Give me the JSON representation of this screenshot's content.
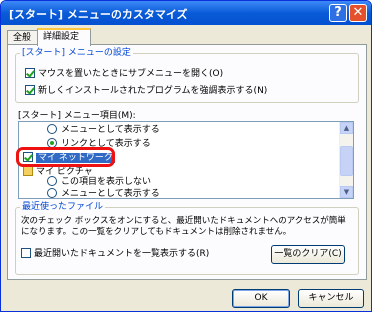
{
  "window": {
    "title": "[スタート] メニューのカスタマイズ",
    "help_label": "?",
    "close_label": "✕"
  },
  "tabs": [
    "全般",
    "詳細設定"
  ],
  "start_settings": {
    "legend": "[スタート] メニューの設定",
    "options": [
      "マウスを置いたときにサブメニューを開く(O)",
      "新しくインストールされたプログラムを強調表示する(N)"
    ]
  },
  "items": {
    "label": "[スタート] メニュー項目(M):",
    "rows": [
      "メニューとして表示する",
      "リンクとして表示する",
      "マイ ネットワーク",
      "マイ ピクチャ",
      "この項目を表示しない",
      "メニューとして表示する"
    ]
  },
  "recent": {
    "legend": "最近使ったファイル",
    "description": "次のチェック ボックスをオンにすると、最近開いたドキュメントへのアクセスが簡単になります。この一覧をクリアしてもドキュメントは削除されません。",
    "checkbox_label": "最近開いたドキュメントを一覧表示する(R)",
    "clear_button": "一覧のクリア(C)"
  },
  "buttons": {
    "ok": "OK",
    "cancel": "キャンセル"
  },
  "colors": {
    "titlebar": "#0a5bd8",
    "highlight_box": "#ee1111",
    "selection": "#316ac5"
  },
  "scroll_arrows": {
    "up": "▲",
    "down": "▼"
  }
}
